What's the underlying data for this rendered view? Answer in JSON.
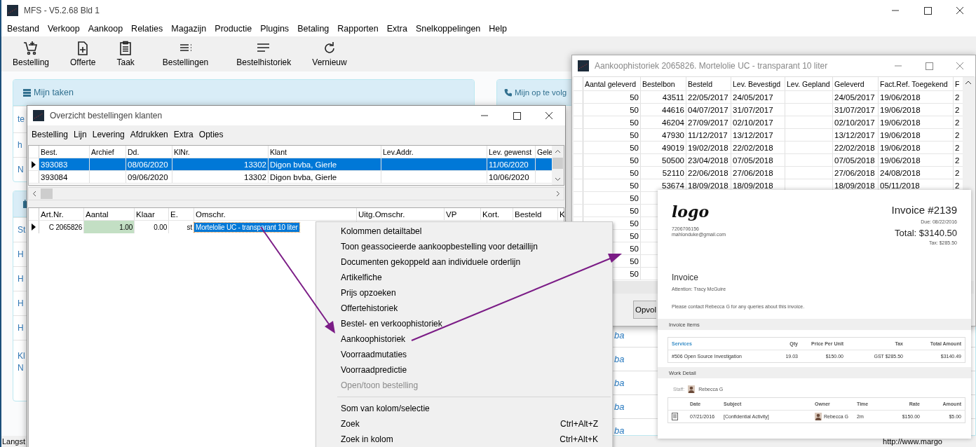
{
  "main_window": {
    "title": "MFS - V5.2.68 Bld 1",
    "menu": [
      "Bestand",
      "Verkoop",
      "Aankoop",
      "Relaties",
      "Magazijn",
      "Productie",
      "Plugins",
      "Betaling",
      "Rapporten",
      "Extra",
      "Snelkoppelingen",
      "Help"
    ],
    "toolbar": [
      "Bestelling",
      "Offerte",
      "Taak",
      "Bestellingen",
      "Bestelhistoriek",
      "Vernieuw"
    ],
    "panels": [
      {
        "title": "Mijn taken",
        "items": [
          [
            "te"
          ],
          [
            "h"
          ],
          [
            "N"
          ]
        ]
      },
      {
        "items": [
          [
            "St"
          ],
          [
            "H"
          ],
          [
            "H"
          ],
          [
            "H"
          ],
          [
            "H"
          ],
          [
            "Kl",
            "N"
          ]
        ]
      }
    ],
    "side_panel": {
      "title": "Mijn op te volg",
      "items": [
        "ba",
        "ba",
        "ba",
        "ba",
        "ba"
      ]
    },
    "status_bar": {
      "left": "Langst",
      "right": "http://www.margo"
    }
  },
  "orders_window": {
    "title": "Overzicht bestellingen klanten",
    "menu": [
      "Bestelling",
      "Lijn",
      "Levering",
      "Afdrukken",
      "Extra",
      "Opties"
    ],
    "orders": {
      "columns": [
        "Best.",
        "Archief",
        "Dd.",
        "KlNr.",
        "Klant",
        "Lev.Addr.",
        "Lev. gewenst",
        "Gele"
      ],
      "rows": [
        {
          "cells": [
            "393083",
            "",
            "08/06/2020",
            "13302",
            "Digon bvba, Gierle",
            "",
            "11/06/2020",
            ""
          ],
          "selected": true
        },
        {
          "cells": [
            "393084",
            "",
            "09/06/2020",
            "13302",
            "Digon bvba, Gierle",
            "",
            "10/06/2020",
            ""
          ],
          "selected": false
        }
      ]
    },
    "lines": {
      "columns": [
        "Art.Nr.",
        "Aantal",
        "Klaar",
        "E.",
        "Omschr.",
        "Uitg.Omschr.",
        "VP",
        "Kort.",
        "Besteld",
        "K"
      ],
      "rows": [
        {
          "current": true,
          "cells": [
            {
              "text": "C 2065826",
              "selected": false
            },
            {
              "text": "1.00",
              "selected": false
            },
            {
              "text": "0.00",
              "selected": false
            },
            {
              "text": "st",
              "selected": false
            },
            {
              "text": "Mortelolie UC - transparant 10 liter",
              "selected": true
            }
          ]
        }
      ]
    }
  },
  "context_menu": [
    {
      "kind": "item",
      "label": "Kolommen detailtabel",
      "disabled": false
    },
    {
      "kind": "item",
      "label": "Toon geassocieerde aankoopbestelling voor detaillijn",
      "disabled": false
    },
    {
      "kind": "item",
      "label": "Documenten gekoppeld aan individuele orderlijn",
      "disabled": false
    },
    {
      "kind": "item",
      "label": "Artikelfiche",
      "disabled": false
    },
    {
      "kind": "item",
      "label": "Prijs opzoeken",
      "disabled": false
    },
    {
      "kind": "item",
      "label": "Offertehistoriek",
      "disabled": false
    },
    {
      "kind": "item",
      "label": "Bestel- en verkoophistoriek",
      "disabled": false
    },
    {
      "kind": "item",
      "label": "Aankoophistoriek",
      "disabled": false
    },
    {
      "kind": "item",
      "label": "Voorraadmutaties",
      "disabled": false
    },
    {
      "kind": "item",
      "label": "Voorraadpredictie",
      "disabled": false
    },
    {
      "kind": "item",
      "label": "Open/toon bestelling",
      "disabled": true
    },
    {
      "kind": "separator"
    },
    {
      "kind": "item",
      "label": "Som van kolom/selectie",
      "disabled": false
    },
    {
      "kind": "item",
      "label": "Zoek",
      "shortcut": "Ctrl+Alt+Z",
      "disabled": false
    },
    {
      "kind": "item",
      "label": "Zoek in kolom",
      "shortcut": "Ctrl+Alt+K",
      "disabled": false
    }
  ],
  "history_window": {
    "title": "Aankoophistoriek 2065826. Mortelolie UC - transparant 10 liter",
    "columns": [
      "Aantal geleverd",
      "Bestelbon",
      "Besteld",
      "Lev. Bevestigd",
      "Lev. Gepland",
      "Geleverd",
      "Fact.Ref. Toegekend",
      "F"
    ],
    "rows": [
      [
        "50",
        "43511",
        "22/05/2017",
        "24/05/2017",
        "",
        "24/05/2017",
        "19/06/2018",
        "2"
      ],
      [
        "50",
        "44616",
        "04/07/2017",
        "31/07/2017",
        "",
        "31/07/2017",
        "19/06/2018",
        "2"
      ],
      [
        "50",
        "46204",
        "27/09/2017",
        "02/10/2017",
        "",
        "02/10/2017",
        "19/06/2018",
        "2"
      ],
      [
        "50",
        "47930",
        "11/12/2017",
        "13/12/2017",
        "",
        "13/12/2017",
        "19/06/2018",
        "2"
      ],
      [
        "50",
        "49019",
        "19/02/2018",
        "22/02/2018",
        "",
        "22/02/2018",
        "19/06/2018",
        "2"
      ],
      [
        "50",
        "50500",
        "23/04/2018",
        "07/05/2018",
        "",
        "07/05/2018",
        "19/06/2018",
        "2"
      ],
      [
        "50",
        "52110",
        "22/06/2018",
        "27/06/2018",
        "",
        "27/06/2018",
        "24/08/2018",
        "2"
      ],
      [
        "50",
        "53674",
        "18/09/2018",
        "18/09/2018",
        "",
        "18/09/2018",
        "05/11/2018",
        "2"
      ],
      [
        "50"
      ],
      [
        "50"
      ],
      [
        "50"
      ],
      [
        "50"
      ],
      [
        "50"
      ],
      [
        "50"
      ],
      [
        "50"
      ]
    ],
    "buttons": [
      "Opvol"
    ]
  },
  "invoice": {
    "logo": "logo",
    "phone": "7206706156",
    "email": "mahlonduke@gmail.com",
    "heading": "Invoice #2139",
    "due": "Due: 08/22/2016",
    "total": "Total: $3140.50",
    "tax": "Tax: $285.50",
    "title": "Invoice",
    "attention": "Attention: Tracy McGuire",
    "note": "Please contact Rebecca G for any queries about this invoice.",
    "items_section": "Invoice items",
    "items_table": {
      "columns": [
        "Services",
        "Qty",
        "Price Per Unit",
        "Tax",
        "Total Amount"
      ],
      "rows": [
        [
          "#506 Open Source Investigation",
          "19.03",
          "$150.00",
          "GST  $285.50",
          "$3140.49"
        ]
      ]
    },
    "work_section": "Work Detail",
    "staff_label": "Staff:",
    "staff_name": "Rebecca G",
    "work_table": {
      "columns": [
        "Date",
        "Subject",
        "Owner",
        "Time",
        "Rate",
        "Amount"
      ],
      "rows": [
        [
          "07/21/2016",
          "[Confidential Activity]",
          "Rebecca G",
          "2m",
          "$150.00",
          "$5.00"
        ]
      ]
    }
  }
}
